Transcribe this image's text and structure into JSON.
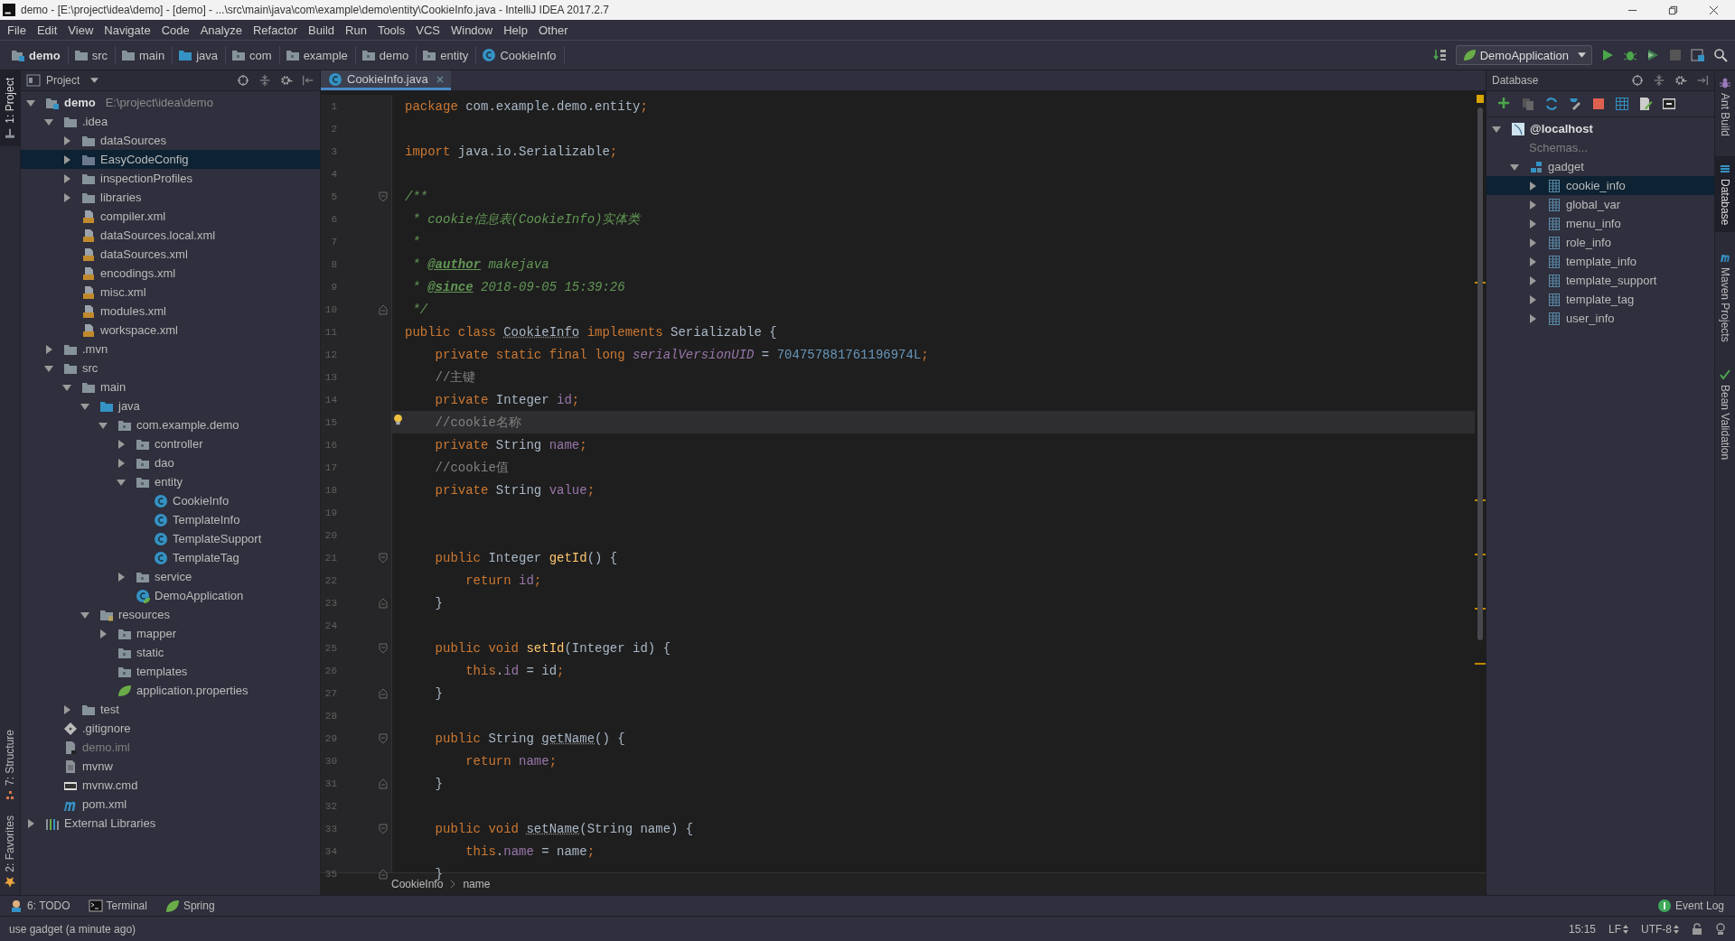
{
  "title_bar": {
    "title": "demo - [E:\\project\\idea\\demo] - [demo] - ...\\src\\main\\java\\com\\example\\demo\\entity\\CookieInfo.java - IntelliJ IDEA 2017.2.7"
  },
  "menu": [
    "File",
    "Edit",
    "View",
    "Navigate",
    "Code",
    "Analyze",
    "Refactor",
    "Build",
    "Run",
    "Tools",
    "VCS",
    "Window",
    "Help",
    "Other"
  ],
  "nav": {
    "crumbs": [
      {
        "label": "demo",
        "kind": "module"
      },
      {
        "label": "src",
        "kind": "folder"
      },
      {
        "label": "main",
        "kind": "folder"
      },
      {
        "label": "java",
        "kind": "src-folder"
      },
      {
        "label": "com",
        "kind": "package"
      },
      {
        "label": "example",
        "kind": "package"
      },
      {
        "label": "demo",
        "kind": "package"
      },
      {
        "label": "entity",
        "kind": "package"
      },
      {
        "label": "CookieInfo",
        "kind": "class"
      }
    ],
    "run_config": "DemoApplication"
  },
  "left_stripe": [
    {
      "label": "1: Project",
      "kind": "project",
      "selected": true
    },
    {
      "label": "7: Structure",
      "kind": "structure",
      "selected": false
    },
    {
      "label": "2: Favorites",
      "kind": "favorites",
      "selected": false
    }
  ],
  "project": {
    "title": "Project",
    "tree": [
      {
        "label": "demo",
        "path": "E:\\project\\idea\\demo",
        "kind": "module",
        "expanded": true,
        "selected": false,
        "children": [
          {
            "label": ".idea",
            "kind": "folder",
            "expanded": true,
            "selected": false,
            "children": [
              {
                "label": "dataSources",
                "kind": "folder",
                "expanded": false,
                "selected": false
              },
              {
                "label": "EasyCodeConfig",
                "kind": "folder",
                "expanded": false,
                "selected": true
              },
              {
                "label": "inspectionProfiles",
                "kind": "folder",
                "expanded": false,
                "selected": false
              },
              {
                "label": "libraries",
                "kind": "folder",
                "expanded": false,
                "selected": false
              },
              {
                "label": "compiler.xml",
                "kind": "xml",
                "selected": false
              },
              {
                "label": "dataSources.local.xml",
                "kind": "xml",
                "selected": false
              },
              {
                "label": "dataSources.xml",
                "kind": "xml",
                "selected": false
              },
              {
                "label": "encodings.xml",
                "kind": "xml",
                "selected": false
              },
              {
                "label": "misc.xml",
                "kind": "xml",
                "selected": false
              },
              {
                "label": "modules.xml",
                "kind": "xml",
                "selected": false
              },
              {
                "label": "workspace.xml",
                "kind": "xml",
                "selected": false
              }
            ]
          },
          {
            "label": ".mvn",
            "kind": "folder",
            "expanded": false,
            "selected": false
          },
          {
            "label": "src",
            "kind": "folder",
            "expanded": true,
            "selected": false,
            "children": [
              {
                "label": "main",
                "kind": "folder",
                "expanded": true,
                "selected": false,
                "children": [
                  {
                    "label": "java",
                    "kind": "src-folder",
                    "expanded": true,
                    "selected": false,
                    "children": [
                      {
                        "label": "com.example.demo",
                        "kind": "package",
                        "expanded": true,
                        "selected": false,
                        "children": [
                          {
                            "label": "controller",
                            "kind": "package",
                            "expanded": false,
                            "selected": false
                          },
                          {
                            "label": "dao",
                            "kind": "package",
                            "expanded": false,
                            "selected": false
                          },
                          {
                            "label": "entity",
                            "kind": "package",
                            "expanded": true,
                            "selected": false,
                            "children": [
                              {
                                "label": "CookieInfo",
                                "kind": "class",
                                "selected": false
                              },
                              {
                                "label": "TemplateInfo",
                                "kind": "class",
                                "selected": false
                              },
                              {
                                "label": "TemplateSupport",
                                "kind": "class",
                                "selected": false
                              },
                              {
                                "label": "TemplateTag",
                                "kind": "class",
                                "selected": false
                              }
                            ]
                          },
                          {
                            "label": "service",
                            "kind": "package",
                            "expanded": false,
                            "selected": false
                          },
                          {
                            "label": "DemoApplication",
                            "kind": "spring-class",
                            "selected": false
                          }
                        ]
                      }
                    ]
                  },
                  {
                    "label": "resources",
                    "kind": "resources",
                    "expanded": true,
                    "selected": false,
                    "children": [
                      {
                        "label": "mapper",
                        "kind": "package",
                        "expanded": false,
                        "selected": false
                      },
                      {
                        "label": "static",
                        "kind": "package",
                        "selected": false
                      },
                      {
                        "label": "templates",
                        "kind": "package",
                        "selected": false
                      },
                      {
                        "label": "application.properties",
                        "kind": "spring-props",
                        "selected": false
                      }
                    ]
                  }
                ]
              },
              {
                "label": "test",
                "kind": "folder",
                "expanded": false,
                "selected": false
              }
            ]
          },
          {
            "label": ".gitignore",
            "kind": "git",
            "selected": false
          },
          {
            "label": "demo.iml",
            "kind": "iml",
            "selected": false
          },
          {
            "label": "mvnw",
            "kind": "file",
            "selected": false
          },
          {
            "label": "mvnw.cmd",
            "kind": "cmd",
            "selected": false
          },
          {
            "label": "pom.xml",
            "kind": "maven",
            "selected": false
          }
        ]
      },
      {
        "label": "External Libraries",
        "kind": "libraries",
        "expanded": false,
        "selected": false
      }
    ]
  },
  "editor": {
    "tabs": [
      {
        "label": "CookieInfo.java",
        "selected": true
      }
    ],
    "lines": [
      {
        "n": "1",
        "current": false,
        "tokens": [
          {
            "t": "package",
            "kind": "kw"
          },
          {
            "t": " com.example.demo.entity",
            "kind": "txt"
          },
          {
            "t": ";",
            "kind": "kw"
          }
        ]
      },
      {
        "n": "2",
        "current": false
      },
      {
        "n": "3",
        "current": false,
        "tokens": [
          {
            "t": "import",
            "kind": "kw"
          },
          {
            "t": " java.io.Serializable",
            "kind": "txt"
          },
          {
            "t": ";",
            "kind": "kw"
          }
        ]
      },
      {
        "n": "4",
        "current": false
      },
      {
        "n": "5",
        "current": false,
        "fold_start": true,
        "tokens": [
          {
            "t": "/**",
            "kind": "doc"
          }
        ]
      },
      {
        "n": "6",
        "current": false,
        "tokens": [
          {
            "t": " * cookie信息表(CookieInfo)实体类",
            "kind": "doc"
          }
        ]
      },
      {
        "n": "7",
        "current": false,
        "tokens": [
          {
            "t": " *",
            "kind": "doc"
          }
        ]
      },
      {
        "n": "8",
        "current": false,
        "tokens": [
          {
            "t": " * ",
            "kind": "doc"
          },
          {
            "t": "@author",
            "kind": "tag"
          },
          {
            "t": " makejava",
            "kind": "doc"
          }
        ]
      },
      {
        "n": "9",
        "current": false,
        "tokens": [
          {
            "t": " * ",
            "kind": "doc"
          },
          {
            "t": "@since",
            "kind": "tag"
          },
          {
            "t": " 2018-09-05 15:39:26",
            "kind": "doc"
          }
        ]
      },
      {
        "n": "10",
        "current": false,
        "fold_end": true,
        "tokens": [
          {
            "t": " */",
            "kind": "doc"
          }
        ]
      },
      {
        "n": "11",
        "current": false,
        "tokens": [
          {
            "t": "public class ",
            "kind": "kw"
          },
          {
            "t": "CookieInfo",
            "kind": "unused"
          },
          {
            "t": " implements",
            "kind": "kw"
          },
          {
            "t": " Serializable {",
            "kind": "txt"
          }
        ]
      },
      {
        "n": "12",
        "current": false,
        "tokens": [
          {
            "t": "    private static final long",
            "kind": "kw"
          },
          {
            "t": " serialVersionUID",
            "kind": "sfld"
          },
          {
            "t": " = ",
            "kind": "txt"
          },
          {
            "t": "704757881761196974L",
            "kind": "num"
          },
          {
            "t": ";",
            "kind": "kw"
          }
        ]
      },
      {
        "n": "13",
        "current": false,
        "tokens": [
          {
            "t": "    //主键",
            "kind": "cmt"
          }
        ]
      },
      {
        "n": "14",
        "current": false,
        "tokens": [
          {
            "t": "    private",
            "kind": "kw"
          },
          {
            "t": " Integer",
            "kind": "txt"
          },
          {
            "t": " id",
            "kind": "fld"
          },
          {
            "t": ";",
            "kind": "kw"
          }
        ]
      },
      {
        "n": "15",
        "current": true,
        "tokens": [
          {
            "t": "    //cookie名称",
            "kind": "cmt"
          }
        ]
      },
      {
        "n": "16",
        "current": false,
        "tokens": [
          {
            "t": "    private",
            "kind": "kw"
          },
          {
            "t": " String",
            "kind": "txt"
          },
          {
            "t": " name",
            "kind": "fld"
          },
          {
            "t": ";",
            "kind": "kw"
          }
        ]
      },
      {
        "n": "17",
        "current": false,
        "tokens": [
          {
            "t": "    //cookie值",
            "kind": "cmt"
          }
        ]
      },
      {
        "n": "18",
        "current": false,
        "tokens": [
          {
            "t": "    private",
            "kind": "kw"
          },
          {
            "t": " String",
            "kind": "txt"
          },
          {
            "t": " value",
            "kind": "fld"
          },
          {
            "t": ";",
            "kind": "kw"
          }
        ]
      },
      {
        "n": "19",
        "current": false
      },
      {
        "n": "20",
        "current": false
      },
      {
        "n": "21",
        "current": false,
        "fold_start": true,
        "tokens": [
          {
            "t": "    public",
            "kind": "kw"
          },
          {
            "t": " Integer",
            "kind": "txt"
          },
          {
            "t": " getId",
            "kind": "fn"
          },
          {
            "t": "() {",
            "kind": "txt"
          }
        ]
      },
      {
        "n": "22",
        "current": false,
        "tokens": [
          {
            "t": "        return",
            "kind": "kw"
          },
          {
            "t": " id",
            "kind": "fld"
          },
          {
            "t": ";",
            "kind": "kw"
          }
        ]
      },
      {
        "n": "23",
        "current": false,
        "fold_end": true,
        "tokens": [
          {
            "t": "    }",
            "kind": "txt"
          }
        ]
      },
      {
        "n": "24",
        "current": false
      },
      {
        "n": "25",
        "current": false,
        "fold_start": true,
        "tokens": [
          {
            "t": "    public void",
            "kind": "kw"
          },
          {
            "t": " setId",
            "kind": "fn"
          },
          {
            "t": "(Integer id) {",
            "kind": "txt"
          }
        ]
      },
      {
        "n": "26",
        "current": false,
        "tokens": [
          {
            "t": "        this",
            "kind": "kw"
          },
          {
            "t": ".",
            "kind": "txt"
          },
          {
            "t": "id",
            "kind": "fld"
          },
          {
            "t": " = id",
            "kind": "txt"
          },
          {
            "t": ";",
            "kind": "kw"
          }
        ]
      },
      {
        "n": "27",
        "current": false,
        "fold_end": true,
        "tokens": [
          {
            "t": "    }",
            "kind": "txt"
          }
        ]
      },
      {
        "n": "28",
        "current": false
      },
      {
        "n": "29",
        "current": false,
        "fold_start": true,
        "tokens": [
          {
            "t": "    public",
            "kind": "kw"
          },
          {
            "t": " String ",
            "kind": "txt"
          },
          {
            "t": "getName",
            "kind": "unused"
          },
          {
            "t": "() {",
            "kind": "txt"
          }
        ]
      },
      {
        "n": "30",
        "current": false,
        "tokens": [
          {
            "t": "        return",
            "kind": "kw"
          },
          {
            "t": " name",
            "kind": "fld"
          },
          {
            "t": ";",
            "kind": "kw"
          }
        ]
      },
      {
        "n": "31",
        "current": false,
        "fold_end": true,
        "tokens": [
          {
            "t": "    }",
            "kind": "txt"
          }
        ]
      },
      {
        "n": "32",
        "current": false
      },
      {
        "n": "33",
        "current": false,
        "fold_start": true,
        "tokens": [
          {
            "t": "    public void ",
            "kind": "kw"
          },
          {
            "t": "setName",
            "kind": "unused"
          },
          {
            "t": "(String name) {",
            "kind": "txt"
          }
        ]
      },
      {
        "n": "34",
        "current": false,
        "tokens": [
          {
            "t": "        this",
            "kind": "kw"
          },
          {
            "t": ".",
            "kind": "txt"
          },
          {
            "t": "name",
            "kind": "fld"
          },
          {
            "t": " = name",
            "kind": "txt"
          },
          {
            "t": ";",
            "kind": "kw"
          }
        ]
      },
      {
        "n": "35",
        "current": false,
        "fold_end": true,
        "tokens": [
          {
            "t": "    }",
            "kind": "txt"
          }
        ]
      }
    ],
    "breadcrumb": [
      "CookieInfo",
      "name"
    ]
  },
  "database": {
    "title": "Database",
    "tree": [
      {
        "label": "@localhost",
        "kind": "host",
        "expanded": true,
        "selected": false,
        "children": [
          {
            "label": "Schemas...",
            "kind": "schemas",
            "selected": false
          },
          {
            "label": "gadget",
            "kind": "schema",
            "expanded": true,
            "selected": false,
            "children": [
              {
                "label": "cookie_info",
                "kind": "table",
                "expanded": false,
                "selected": true
              },
              {
                "label": "global_var",
                "kind": "table",
                "expanded": false,
                "selected": false
              },
              {
                "label": "menu_info",
                "kind": "table",
                "expanded": false,
                "selected": false
              },
              {
                "label": "role_info",
                "kind": "table",
                "expanded": false,
                "selected": false
              },
              {
                "label": "template_info",
                "kind": "table",
                "expanded": false,
                "selected": false
              },
              {
                "label": "template_support",
                "kind": "table",
                "expanded": false,
                "selected": false
              },
              {
                "label": "template_tag",
                "kind": "table",
                "expanded": false,
                "selected": false
              },
              {
                "label": "user_info",
                "kind": "table",
                "expanded": false,
                "selected": false
              }
            ]
          }
        ]
      }
    ]
  },
  "right_stripe": [
    {
      "label": "Ant Build",
      "kind": "ant",
      "selected": false
    },
    {
      "label": "Database",
      "kind": "database",
      "selected": true
    },
    {
      "label": "Maven Projects",
      "kind": "maven",
      "selected": false
    },
    {
      "label": "Bean Validation",
      "kind": "bean",
      "selected": false
    }
  ],
  "tool_buttons": [
    {
      "label": "6: TODO",
      "kind": "todo"
    },
    {
      "label": "Terminal",
      "kind": "terminal"
    },
    {
      "label": "Spring",
      "kind": "spring"
    }
  ],
  "event_log": {
    "label": "Event Log"
  },
  "status_bar": {
    "message": "use gadget (a minute ago)",
    "position": "15:15",
    "line_separator": "LF",
    "encoding": "UTF-8"
  }
}
